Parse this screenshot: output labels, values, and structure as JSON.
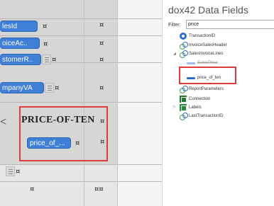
{
  "designer": {
    "fields": {
      "sales_id": "lesId",
      "invoice_ac": "oiceAc..",
      "customer_r": "stomerR..",
      "company_va": "mpanyVA",
      "price_of_label": "PRICE-OF-TEN",
      "price_of_field": "price_of_..."
    },
    "marks": {
      "pilcrow": "¤",
      "double_pilcrow": "¤¤",
      "big_k": "<"
    }
  },
  "data_fields_pane": {
    "title": "dox42 Data Fields",
    "filter_label": "Filter:",
    "filter_value": "price",
    "tree": [
      {
        "label": "TransactionID",
        "icon": "entity-icon"
      },
      {
        "label": "InvoiceSalesHeader",
        "icon": "relation-icon"
      },
      {
        "label": "SalesInvoiceLines",
        "icon": "relation-icon",
        "expanded": true
      },
      {
        "label": "SalesPrice",
        "icon": "field-icon"
      },
      {
        "label": "price_of_ten",
        "icon": "field-icon",
        "highlighted": true
      },
      {
        "label": "ReportParameters",
        "icon": "relation-icon"
      },
      {
        "label": "Connection",
        "icon": "connection-icon"
      },
      {
        "label": "Labels",
        "icon": "labels-icon"
      },
      {
        "label": "LastTransactionID",
        "icon": "relation-icon"
      }
    ],
    "expander_expanded": "◢",
    "expander_collapsed": "▷"
  },
  "colors": {
    "field_chip": "#3f7fd6",
    "highlight": "#e23b3b",
    "designer_grey": "#d6d6d4"
  }
}
